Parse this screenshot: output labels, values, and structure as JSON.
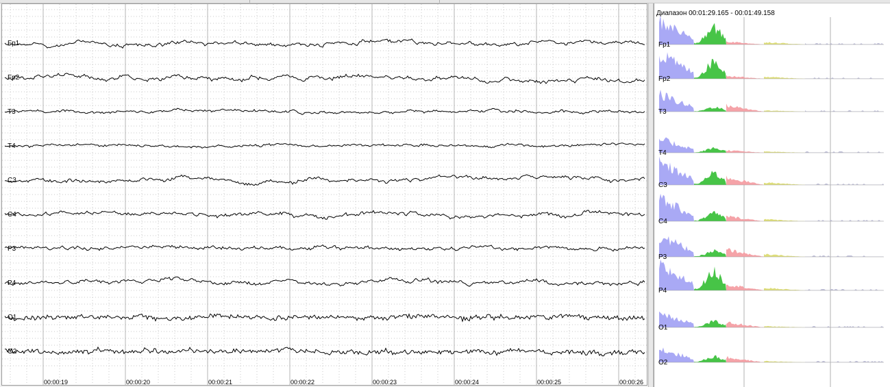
{
  "eeg": {
    "channels": [
      {
        "label": "Fp1",
        "amp": 1.3,
        "noise": 0.25
      },
      {
        "label": "Fp2",
        "amp": 1.4,
        "noise": 0.25
      },
      {
        "label": "T3",
        "amp": 0.8,
        "noise": 0.3
      },
      {
        "label": "T4",
        "amp": 0.7,
        "noise": 0.3
      },
      {
        "label": "C3",
        "amp": 1.1,
        "noise": 0.35
      },
      {
        "label": "C4",
        "amp": 1.2,
        "noise": 0.35
      },
      {
        "label": "P3",
        "amp": 1.0,
        "noise": 0.4
      },
      {
        "label": "P4",
        "amp": 1.2,
        "noise": 0.4
      },
      {
        "label": "O1",
        "amp": 0.9,
        "noise": 0.9
      },
      {
        "label": "O2",
        "amp": 0.9,
        "noise": 0.9
      }
    ],
    "time_labels": [
      "00:00:19",
      "00:00:20",
      "00:00:21",
      "00:00:22",
      "00:00:23",
      "00:00:24",
      "00:00:25",
      "00:00:26"
    ],
    "trace_color": "#000000",
    "grid_major_color": "#b4b4b4",
    "grid_minor_color": "#c8c8c8"
  },
  "spectrum": {
    "range_prefix": "Диапазон ",
    "range_start": "00:01:29.165",
    "range_sep": " - ",
    "range_end": "00:01:49.158",
    "channels": [
      "Fp1",
      "Fp2",
      "T3",
      "T4",
      "C3",
      "C4",
      "P3",
      "P4",
      "O1",
      "O2"
    ],
    "band_colors": {
      "delta": "#a9a9f5",
      "theta": "#47c447",
      "alpha": "#f5a3a8",
      "beta": "#dede7a",
      "gamma": "#c0c0d8"
    },
    "band_peaks": [
      {
        "delta": 0.95,
        "theta": 0.7,
        "alpha": 0.12,
        "beta": 0.1
      },
      {
        "delta": 1.0,
        "theta": 0.75,
        "alpha": 0.12,
        "beta": 0.08
      },
      {
        "delta": 0.7,
        "theta": 0.2,
        "alpha": 0.25,
        "beta": 0.05
      },
      {
        "delta": 0.55,
        "theta": 0.2,
        "alpha": 0.1,
        "beta": 0.05
      },
      {
        "delta": 0.9,
        "theta": 0.5,
        "alpha": 0.3,
        "beta": 0.1
      },
      {
        "delta": 0.9,
        "theta": 0.35,
        "alpha": 0.2,
        "beta": 0.08
      },
      {
        "delta": 0.85,
        "theta": 0.25,
        "alpha": 0.3,
        "beta": 0.1
      },
      {
        "delta": 1.0,
        "theta": 0.8,
        "alpha": 0.25,
        "beta": 0.1
      },
      {
        "delta": 0.6,
        "theta": 0.25,
        "alpha": 0.2,
        "beta": 0.05
      },
      {
        "delta": 0.55,
        "theta": 0.25,
        "alpha": 0.2,
        "beta": 0.05
      }
    ]
  }
}
